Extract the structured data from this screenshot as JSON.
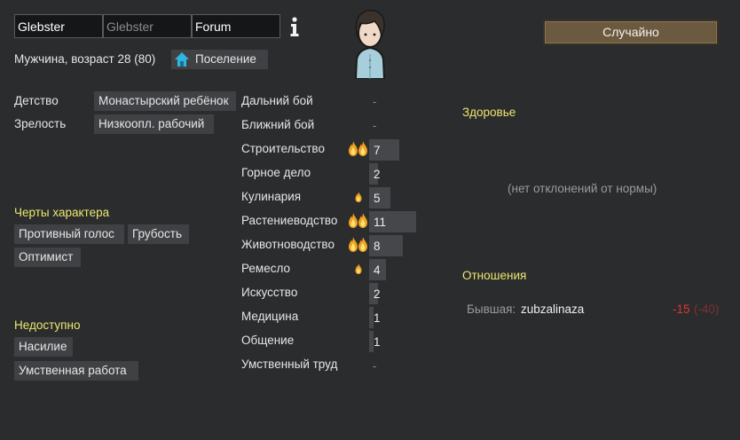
{
  "name_fields": {
    "first": "Glebster",
    "nick_placeholder": "Glebster",
    "last": "Forum"
  },
  "identity": {
    "gender_age": "Мужчина, возраст 28 (80)",
    "faction": "Поселение"
  },
  "backstory": {
    "childhood_label": "Детство",
    "childhood_value": "Монастырский ребёнок",
    "adulthood_label": "Зрелость",
    "adulthood_value": "Низкоопл. рабочий"
  },
  "traits": {
    "title": "Черты характера",
    "items": [
      "Противный голос",
      "Грубость",
      "Оптимист"
    ]
  },
  "incapable": {
    "title": "Недоступно",
    "items": [
      "Насилие",
      "Умственная работа"
    ]
  },
  "skills": [
    {
      "name": "Дальний бой",
      "value": "-",
      "level": null,
      "passion": "none"
    },
    {
      "name": "Ближний бой",
      "value": "-",
      "level": null,
      "passion": "none"
    },
    {
      "name": "Строительство",
      "value": "7",
      "level": 7,
      "passion": "major"
    },
    {
      "name": "Горное дело",
      "value": "2",
      "level": 2,
      "passion": "none"
    },
    {
      "name": "Кулинария",
      "value": "5",
      "level": 5,
      "passion": "minor"
    },
    {
      "name": "Растениеводство",
      "value": "11",
      "level": 11,
      "passion": "major"
    },
    {
      "name": "Животноводство",
      "value": "8",
      "level": 8,
      "passion": "major"
    },
    {
      "name": "Ремесло",
      "value": "4",
      "level": 4,
      "passion": "minor"
    },
    {
      "name": "Искусство",
      "value": "2",
      "level": 2,
      "passion": "none"
    },
    {
      "name": "Медицина",
      "value": "1",
      "level": 1,
      "passion": "none"
    },
    {
      "name": "Общение",
      "value": "1",
      "level": 1,
      "passion": "none"
    },
    {
      "name": "Умственный труд",
      "value": "-",
      "level": null,
      "passion": "none"
    }
  ],
  "randomize_button": "Случайно",
  "health": {
    "title": "Здоровье",
    "status": "(нет отклонений от нормы)"
  },
  "relations": {
    "title": "Отношения",
    "items": [
      {
        "type": "Бывшая:",
        "name": "zubzalinaza",
        "opinion": "-15",
        "opinion_them": "(-40)"
      }
    ]
  },
  "colors": {
    "background": "#2b2c2e",
    "section_title": "#ece86c",
    "negative": "#e03434",
    "negative_dim": "#7d3131"
  },
  "icons": [
    "info-icon",
    "home-icon",
    "flame-icon",
    "portrait"
  ]
}
